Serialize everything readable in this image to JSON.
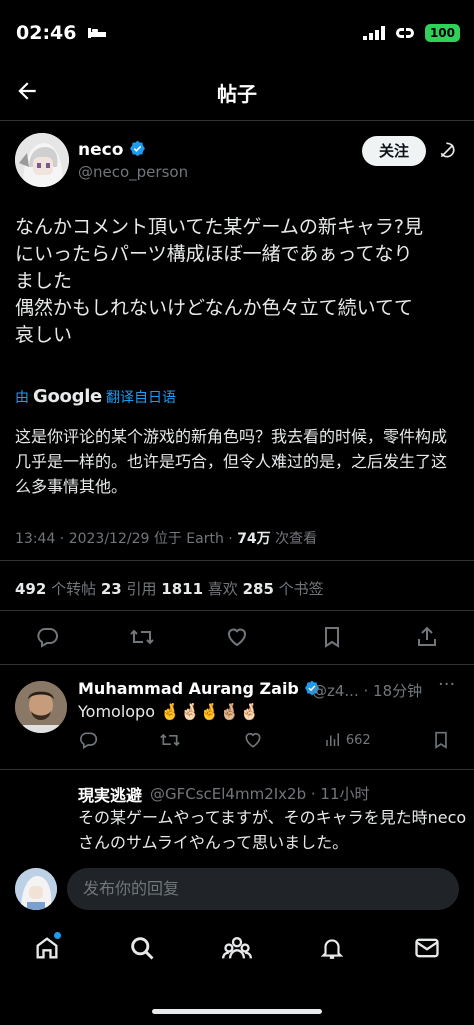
{
  "status_bar": {
    "time": "02:46",
    "battery": "100"
  },
  "header": {
    "title": "帖子"
  },
  "post": {
    "author_name": "neco",
    "author_handle": "@neco_person",
    "follow_label": "关注",
    "text": "なんかコメント頂いてた某ゲームの新キャラ?見\nにいったらパーツ構成ほぼ一緒であぁってなり\nました\n偶然かもしれないけどなんか色々立て続いてて\n哀しい",
    "translate_prefix": "由",
    "translate_brand": "Google",
    "translate_suffix": "翻译自日语",
    "translated_text": "这是你评论的某个游戏的新角色吗？我去看的时候，零件构成几乎是一样的。也许是巧合，但令人难过的是，之后发生了这么多事情其他。",
    "meta_time": "13:44 · 2023/12/29 位于 Earth · ",
    "meta_views": "74万",
    "meta_views_label": " 次查看",
    "stats": {
      "reposts": "492",
      "reposts_label": " 个转帖  ",
      "quotes": "23",
      "quotes_label": " 引用  ",
      "likes": "1811",
      "likes_label": " 喜欢  ",
      "bookmarks": "285",
      "bookmarks_label": " 个书签"
    }
  },
  "replies": [
    {
      "name": "Muhammad Aurang Zaib",
      "handle": "@z4... · 18分钟",
      "text": "Yomolopo 🤞🤞🏻🤞🤞🏼🤞🏻",
      "views": "662"
    },
    {
      "name": "現実逃避",
      "handle": "@GFCscEl4mm2Ix2b · 11小时",
      "text": "その某ゲームやってますが、そのキャラを見た時necoさんのサムライやんって思いました。"
    }
  ],
  "compose": {
    "placeholder": "发布你的回复"
  },
  "colors": {
    "accent": "#1d9bf0",
    "verified": "#1d9bf0",
    "battery": "#30d158"
  }
}
